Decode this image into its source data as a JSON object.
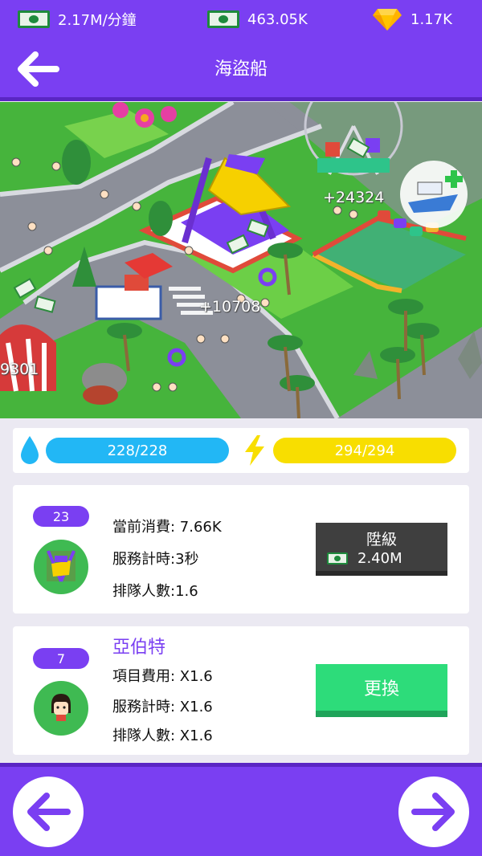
{
  "header": {
    "income": "2.17M/分鐘",
    "cash": "463.05K",
    "gems": "1.17K",
    "title": "海盜船"
  },
  "scene": {
    "floating_texts": [
      "+24324",
      "+10708",
      "9301"
    ]
  },
  "resources": {
    "water": "228/228",
    "energy": "294/294"
  },
  "ride": {
    "level": "23",
    "current_cost": "當前消費: 7.66K",
    "service_time": "服務計時:3秒",
    "queue": "排隊人數:1.6",
    "upgrade_label": "陞級",
    "upgrade_cost": "2.40M"
  },
  "staff": {
    "level": "7",
    "name": "亞伯特",
    "cost_bonus": "項目費用: X1.6",
    "service_bonus": "服務計時: X1.6",
    "queue_bonus": "排隊人數: X1.6",
    "swap_label": "更換"
  },
  "colors": {
    "purple": "#7a3ff2",
    "water": "#22b7f5",
    "energy": "#f8de00",
    "green_button": "#2ddc7a",
    "upgrade_button": "#3f3f3f"
  },
  "icons": [
    "cash-icon",
    "gem-icon",
    "back-arrow-icon",
    "water-drop-icon",
    "lightning-icon",
    "pirate-ship-icon",
    "girl-avatar-icon",
    "left-arrow-icon",
    "right-arrow-icon"
  ]
}
